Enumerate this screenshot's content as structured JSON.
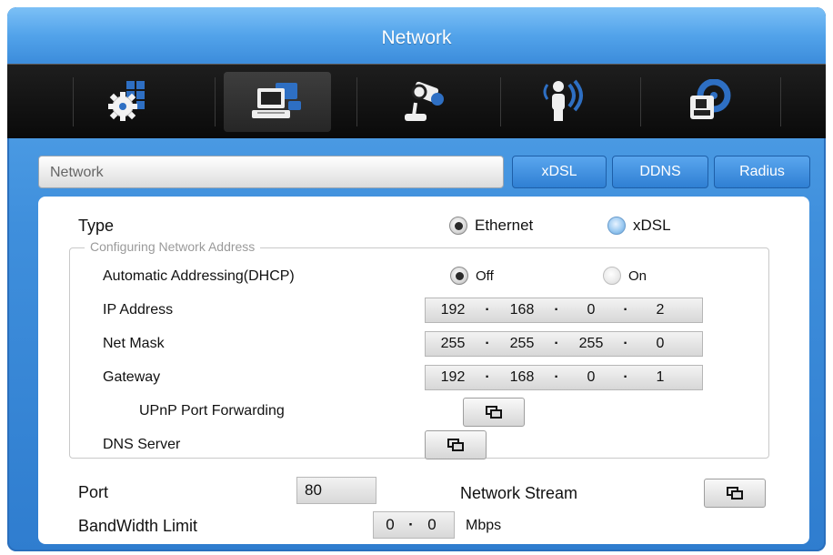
{
  "window": {
    "title": "Network"
  },
  "toolbar": {
    "items": [
      {
        "icon": "settings-grid-icon"
      },
      {
        "icon": "network-computer-icon"
      },
      {
        "icon": "camera-icon"
      },
      {
        "icon": "wireless-user-icon"
      },
      {
        "icon": "storage-disk-icon"
      }
    ],
    "active_index": 1
  },
  "tabs": {
    "current": "Network",
    "items": [
      "xDSL",
      "DDNS",
      "Radius"
    ]
  },
  "form": {
    "type_label": "Type",
    "type_options": [
      "Ethernet",
      "xDSL"
    ],
    "type_selected": "Ethernet",
    "fieldset_legend": "Configuring Network Address",
    "dhcp_label": "Automatic Addressing(DHCP)",
    "dhcp_options": [
      "Off",
      "On"
    ],
    "dhcp_selected": "Off",
    "ip_label": "IP Address",
    "ip": [
      "192",
      "168",
      "0",
      "2"
    ],
    "mask_label": "Net Mask",
    "mask": [
      "255",
      "255",
      "255",
      "0"
    ],
    "gateway_label": "Gateway",
    "gateway": [
      "192",
      "168",
      "0",
      "1"
    ],
    "upnp_label": "UPnP Port Forwarding",
    "dns_label": "DNS Server",
    "port_label": "Port",
    "port_value": "80",
    "stream_label": "Network Stream",
    "bandwidth_label": "BandWidth Limit",
    "bandwidth": [
      "0",
      "0"
    ],
    "bandwidth_unit": "Mbps"
  },
  "colors": {
    "accent": "#3f8fdc",
    "toolbar_bg": "#111111"
  }
}
